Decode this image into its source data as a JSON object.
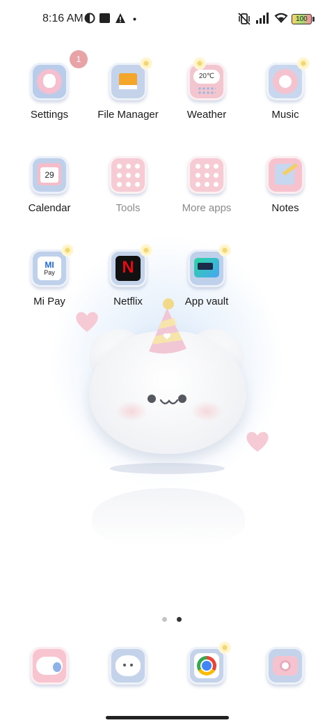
{
  "status_bar": {
    "time": "8:16 AM",
    "battery": "100",
    "icons": [
      "vpn-half-circle-icon",
      "square-icon",
      "warning-icon",
      "dot-icon",
      "vibrate-off-icon",
      "signal-icon",
      "wifi-icon",
      "battery-icon"
    ]
  },
  "apps": [
    {
      "label": "Settings",
      "badge": "1",
      "color": "#b9cce9"
    },
    {
      "label": "File Manager",
      "color": "#c4d3ea"
    },
    {
      "label": "Weather",
      "temp": "20℃",
      "color": "#f3c6cf"
    },
    {
      "label": "Music",
      "color": "#c8d6ee"
    },
    {
      "label": "Calendar",
      "date": "29",
      "color": "#bfd0ea"
    },
    {
      "label": "Tools",
      "color": "#f7cbd3"
    },
    {
      "label": "More apps",
      "color": "#f7cbd3"
    },
    {
      "label": "Notes",
      "color": "#f5c2cd"
    },
    {
      "label": "Mi Pay",
      "logo_top": "MI",
      "logo_bottom": "Pay",
      "color": "#bfd0ea"
    },
    {
      "label": "Netflix",
      "logo": "N",
      "color": "#c4d3ea"
    },
    {
      "label": "App vault",
      "color": "#bfd0ea"
    }
  ],
  "dock": [
    {
      "name": "dock-messaging",
      "color": "#f7c4cf"
    },
    {
      "name": "dock-contacts",
      "color": "#c4d3ea"
    },
    {
      "name": "dock-chrome",
      "color": "#c4d3ea"
    },
    {
      "name": "dock-camera",
      "color": "#c4d3ea"
    }
  ],
  "page_indicator": {
    "count": 2,
    "active": 2
  }
}
